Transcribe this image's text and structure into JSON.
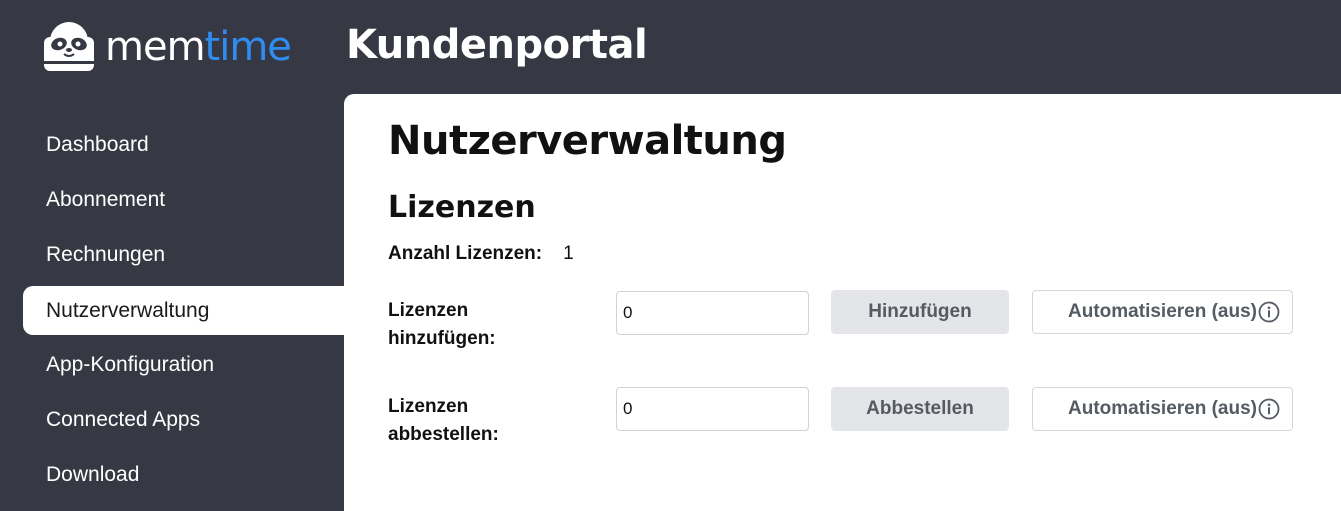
{
  "header": {
    "logo_part1": "mem",
    "logo_part2": "time",
    "title": "Kundenportal",
    "logo_icon": "sloth-logo-icon"
  },
  "sidebar": {
    "items": [
      {
        "label": "Dashboard",
        "active": false
      },
      {
        "label": "Abonnement",
        "active": false
      },
      {
        "label": "Rechnungen",
        "active": false
      },
      {
        "label": "Nutzerverwaltung",
        "active": true
      },
      {
        "label": "App-Konfiguration",
        "active": false
      },
      {
        "label": "Connected Apps",
        "active": false
      },
      {
        "label": "Download",
        "active": false
      }
    ]
  },
  "main": {
    "page_title": "Nutzerverwaltung",
    "section_title": "Lizenzen",
    "license_count_label": "Anzahl Lizenzen:",
    "license_count_value": "1",
    "add": {
      "label_line1": "Lizenzen",
      "label_line2": "hinzufügen:",
      "input_value": "0",
      "button_label": "Hinzufügen",
      "auto_label": "Automatisieren (aus)",
      "info_icon": "info-icon"
    },
    "remove": {
      "label_line1": "Lizenzen",
      "label_line2": "abbestellen:",
      "input_value": "0",
      "button_label": "Abbestellen",
      "auto_label": "Automatisieren (aus)",
      "info_icon": "info-icon"
    }
  },
  "colors": {
    "dark_bg": "#363944",
    "accent_blue": "#2f8cf0",
    "button_gray": "#e3e5e9"
  }
}
